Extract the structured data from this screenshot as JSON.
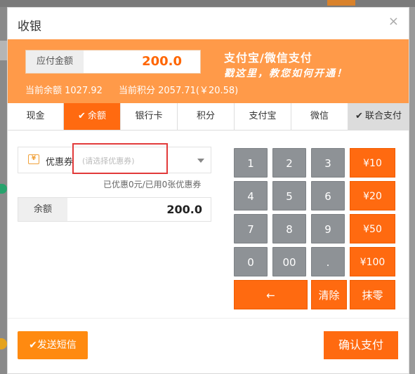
{
  "dialog": {
    "title": "收银",
    "close_symbol": "×"
  },
  "banner": {
    "amount_label": "应付金额",
    "amount_value": "200.0",
    "promo_title": "支付宝/微信支付",
    "promo_subtitle": "戳这里，教您如何开通！",
    "current_balance": "当前余额 1027.92",
    "current_points": "当前积分 2057.71(￥20.58)"
  },
  "tabs": [
    {
      "label": "现金",
      "active": false
    },
    {
      "label": "余额",
      "active": true,
      "checked": true
    },
    {
      "label": "银行卡",
      "active": false
    },
    {
      "label": "积分",
      "active": false
    },
    {
      "label": "支付宝",
      "active": false
    },
    {
      "label": "微信",
      "active": false
    },
    {
      "label": "联合支付",
      "active": false,
      "checked": true
    }
  ],
  "coupon": {
    "icon": "ticket-icon",
    "label": "优惠券",
    "placeholder": "(请选择优惠券)",
    "note": "已优惠0元/已用0张优惠券"
  },
  "balance_field": {
    "label": "余额",
    "value": "200.0"
  },
  "keypad": {
    "digits": [
      "1",
      "2",
      "3",
      "4",
      "5",
      "6",
      "7",
      "8",
      "9",
      "0",
      "00",
      "."
    ],
    "quick_amounts": [
      "¥10",
      "¥20",
      "¥50",
      "¥100"
    ],
    "backspace": "←",
    "clear": "清除",
    "round_off": "抹零"
  },
  "footer": {
    "sms_button": "✔发送短信",
    "confirm_button": "确认支付"
  },
  "colors": {
    "primary": "#ff6a10",
    "banner": "#ff9a49",
    "key_gray": "#8e9296",
    "highlight": "#e23a3a"
  }
}
